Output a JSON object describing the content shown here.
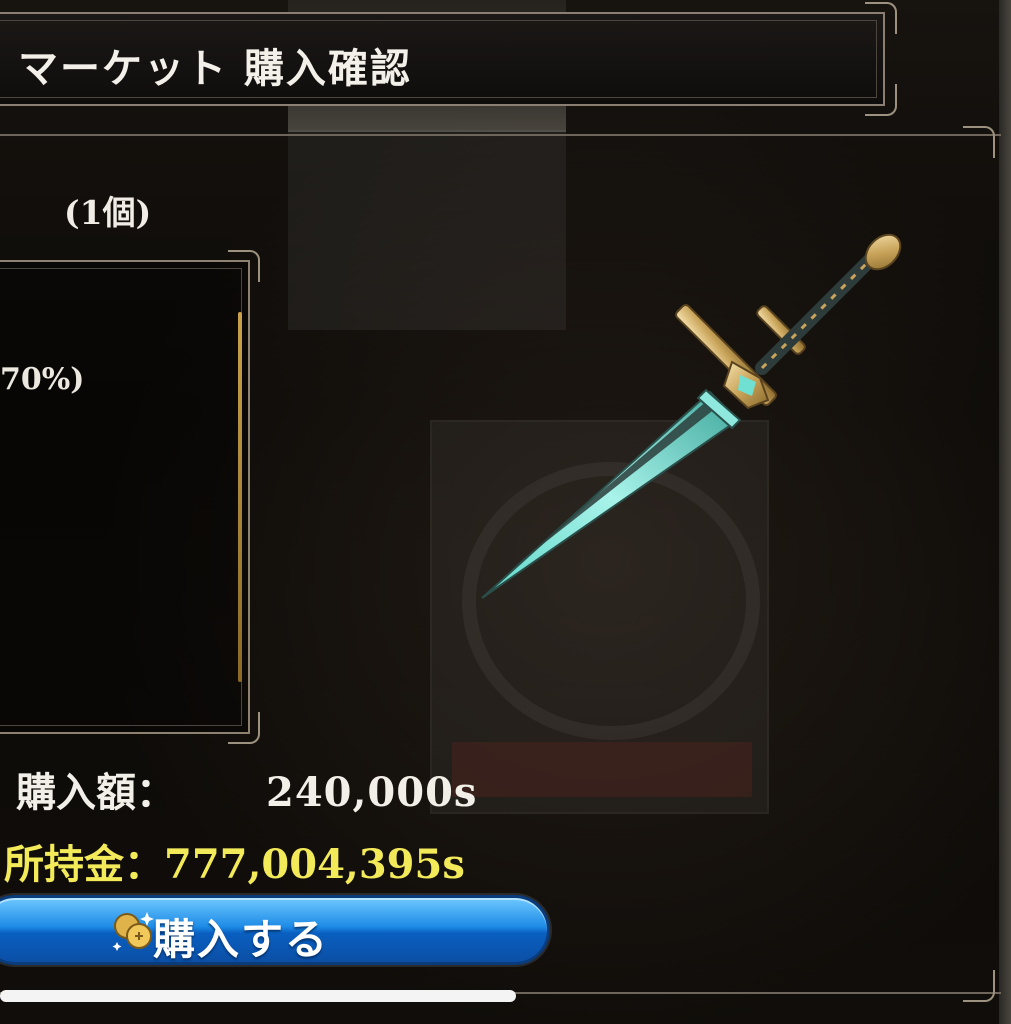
{
  "header": {
    "title": "マーケット 購入確認"
  },
  "item": {
    "quantity": "(1個)",
    "description_fragment": "70%)"
  },
  "purchase": {
    "price_label": "購入額：",
    "price_value": "240,000s",
    "money_label": "所持金：",
    "money_value": "777,004,395s"
  },
  "buy_button": {
    "label": "購入する",
    "icon": "coin-icon"
  },
  "colors": {
    "gold_text": "#f3ea5a",
    "button_blue": "#1d8be6",
    "blade": "#7fe6d8",
    "frame": "#8a7f72"
  }
}
